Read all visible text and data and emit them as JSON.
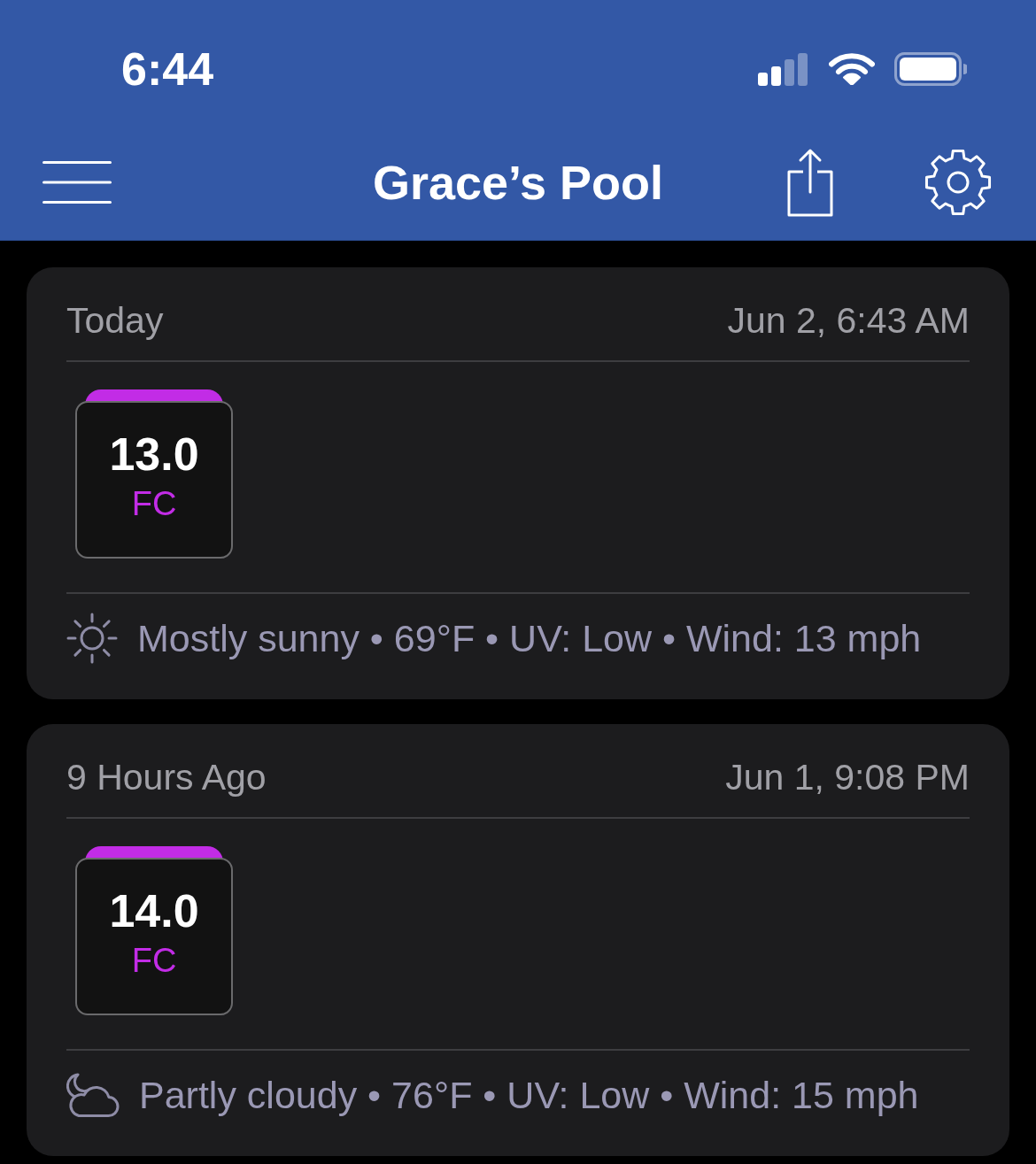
{
  "status_bar": {
    "time": "6:44"
  },
  "header": {
    "title": "Grace’s Pool"
  },
  "entries": [
    {
      "label": "Today",
      "timestamp": "Jun 2, 6:43 AM",
      "readings": [
        {
          "value": "13.0",
          "name": "FC",
          "color": "#c22ce6"
        }
      ],
      "weather": {
        "kind": "sunny",
        "text": "Mostly sunny • 69°F • UV: Low • Wind: 13 mph"
      }
    },
    {
      "label": "9 Hours Ago",
      "timestamp": "Jun 1, 9:08 PM",
      "readings": [
        {
          "value": "14.0",
          "name": "FC",
          "color": "#c22ce6"
        }
      ],
      "weather": {
        "kind": "partly_cloudy",
        "text": "Partly cloudy • 76°F • UV: Low • Wind: 15 mph"
      }
    }
  ]
}
